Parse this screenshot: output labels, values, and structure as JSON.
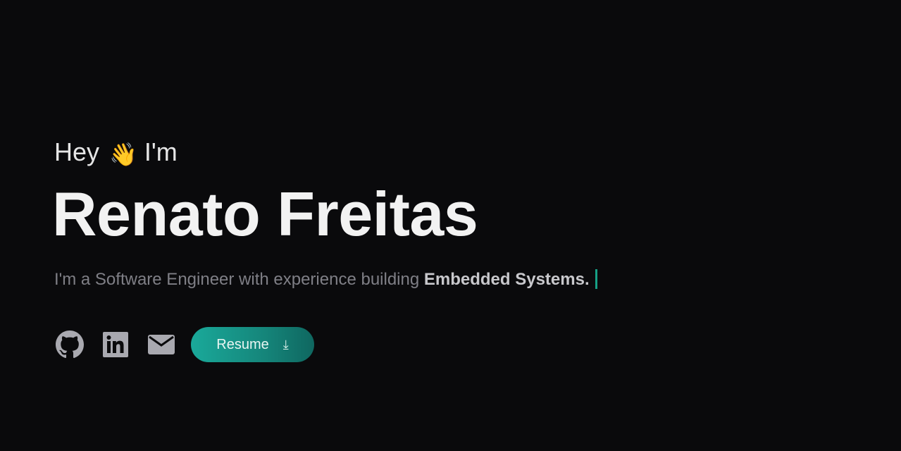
{
  "hero": {
    "greeting_before": "Hey",
    "greeting_emoji": "👋",
    "greeting_after": "I'm",
    "name": "Renato Freitas",
    "tagline_prefix": "I'm a Software Engineer with experience building",
    "tagline_highlight": "Embedded Systems."
  },
  "actions": {
    "links": [
      {
        "icon": "github-icon"
      },
      {
        "icon": "linkedin-icon"
      },
      {
        "icon": "mail-icon"
      }
    ],
    "resume_label": "Resume",
    "resume_icon": "download-icon",
    "resume_icon_glyph": "⤓"
  },
  "colors": {
    "background": "#0a0a0c",
    "accent": "#16a085",
    "text_primary": "#f2f2f2",
    "text_muted": "#7f7f86",
    "icon": "#a9a9b0"
  }
}
